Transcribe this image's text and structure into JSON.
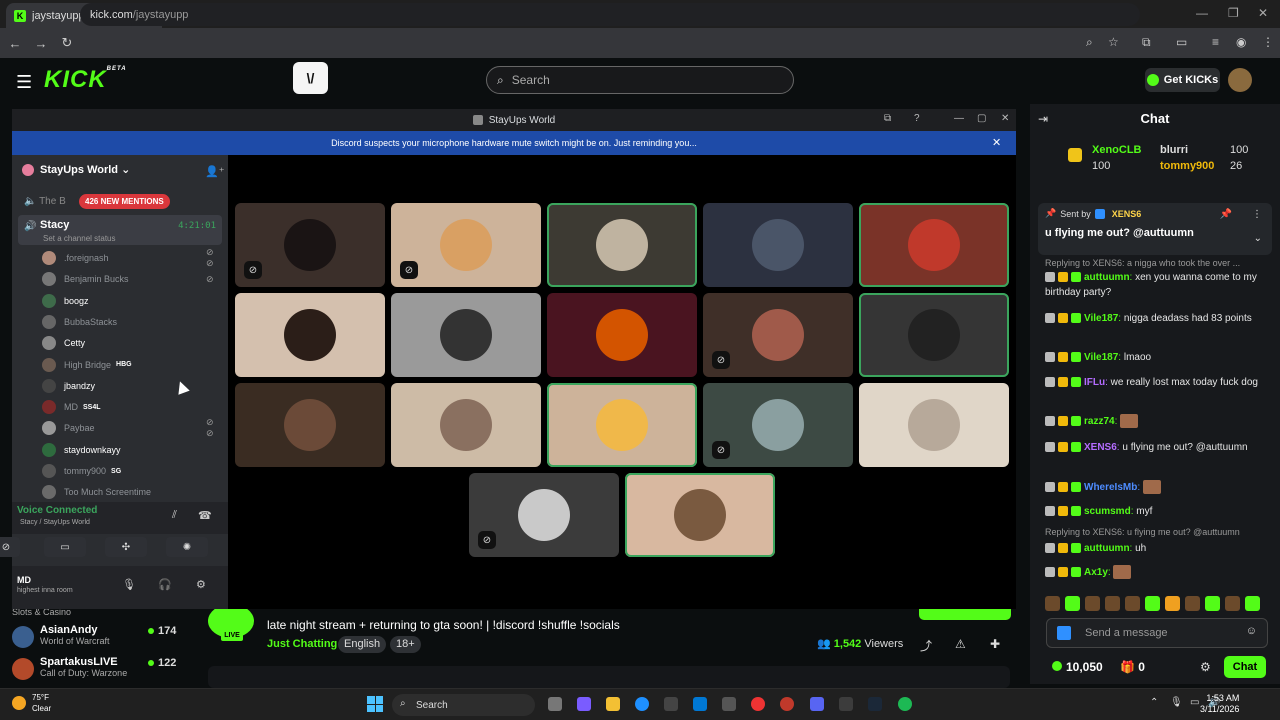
{
  "browser": {
    "tab_title": "jaystayupp Stream - Watch Live",
    "url_host": "kick.com",
    "url_path": "/jaystayupp"
  },
  "kick": {
    "logo": "KICK",
    "logo_sup": "BETA",
    "search_placeholder": "Search",
    "get_kicks_label": "Get KICKs",
    "chat_title": "Chat",
    "leaderboard": [
      {
        "name": "XenoCLB",
        "value": "100"
      },
      {
        "name": "blurri",
        "value": "100"
      },
      {
        "name": "tommy900",
        "value": "26"
      }
    ],
    "leaderboard_extra": "100",
    "pinned": {
      "sent_by_label": "Sent by",
      "sender": "XENS6",
      "message": "u flying me out? @auttuumn"
    },
    "chat_messages": [
      {
        "type": "reply",
        "text": "Replying to XENS6: a nigga who took the over ..."
      },
      {
        "type": "msg",
        "user": "auttuumn",
        "color": "#53fc18",
        "text": "xen you wanna come to my birthday party?"
      },
      {
        "type": "msg",
        "user": "Vile187",
        "color": "#53fc18",
        "text": "nigga deadass had 83 points"
      },
      {
        "type": "msg",
        "user": "Vile187",
        "color": "#53fc18",
        "text": "lmaoo"
      },
      {
        "type": "msg",
        "user": "IFLu",
        "color": "#b46cff",
        "text": "we really lost max today fuck dog"
      },
      {
        "type": "msg",
        "user": "razz74",
        "color": "#53fc18",
        "text": ""
      },
      {
        "type": "msg",
        "user": "XENS6",
        "color": "#b46cff",
        "text": "u flying me out? @auttuumn"
      },
      {
        "type": "msg",
        "user": "WhereIsMb",
        "color": "#4d8cff",
        "text": ""
      },
      {
        "type": "msg",
        "user": "scumsmd",
        "color": "#53fc18",
        "text": "myf"
      },
      {
        "type": "reply",
        "text": "Replying to XENS6: u flying me out? @auttuumn"
      },
      {
        "type": "msg",
        "user": "auttuumn",
        "color": "#53fc18",
        "text": "uh"
      },
      {
        "type": "msg",
        "user": "Ax1y",
        "color": "#53fc18",
        "text": ""
      }
    ],
    "chat_input_placeholder": "Send a message",
    "kicks_balance": "10,050",
    "gift_count": "0",
    "chat_button": "Chat",
    "sidebar_channels": [
      {
        "name": "AsianAndy",
        "category": "World of Warcraft",
        "viewers": "174",
        "avatar_color": "#3a5f8f"
      },
      {
        "name": "SpartakusLIVE",
        "category": "Call of Duty: Warzone",
        "viewers": "122",
        "avatar_color": "#b34a2a"
      }
    ],
    "sidebar_peek": "Slots & Casino",
    "stream": {
      "title": "late night stream + returning to gta soon! | !discord !shuffle !socials",
      "category": "Just Chatting",
      "tags": [
        "English",
        "18+"
      ],
      "viewers": "1,542",
      "viewers_label": "Viewers",
      "live_label": "LIVE"
    }
  },
  "discord": {
    "window_title": "StayUps World",
    "notice": "Discord suspects your microphone hardware mute switch might be on. Just reminding you...",
    "server_name": "StayUps World",
    "channel_above": "The B",
    "mentions_badge": "426 NEW MENTIONS",
    "voice_channel": {
      "name": "Stacy",
      "status": "Set a channel status",
      "timer": "4:21:01"
    },
    "members": [
      {
        "name": ".foreignash",
        "active": false,
        "tag": "",
        "icons": "muted-deafened"
      },
      {
        "name": "Benjamin Bucks",
        "active": false,
        "tag": "",
        "icons": "muted"
      },
      {
        "name": "boogz",
        "active": true,
        "tag": "",
        "icons": ""
      },
      {
        "name": "BubbaStacks",
        "active": false,
        "tag": "",
        "icons": ""
      },
      {
        "name": "Cetty",
        "active": true,
        "tag": "",
        "icons": ""
      },
      {
        "name": "High Bridge",
        "active": false,
        "tag": "HBG",
        "icons": ""
      },
      {
        "name": "jbandzy",
        "active": true,
        "tag": "",
        "icons": ""
      },
      {
        "name": "MD",
        "active": false,
        "tag": "SS4L",
        "icons": ""
      },
      {
        "name": "Paybae",
        "active": false,
        "tag": "",
        "icons": "muted-deafened"
      },
      {
        "name": "staydownkayy",
        "active": true,
        "tag": "",
        "icons": ""
      },
      {
        "name": "tommy900",
        "active": false,
        "tag": "SG",
        "icons": ""
      },
      {
        "name": "Too Much Screentime",
        "active": false,
        "tag": "",
        "icons": ""
      }
    ],
    "voice_connected": "Voice Connected",
    "voice_sub": "Stacy / StayUps World",
    "user": {
      "name": "MD",
      "status": "highest inna room"
    },
    "tiles": [
      {
        "bg": "#3b2f2a",
        "pfp": "#1a1414",
        "speaking": false,
        "muted": true
      },
      {
        "bg": "#cdb39a",
        "pfp": "#d9a063",
        "speaking": false,
        "muted": true
      },
      {
        "bg": "#3d3a33",
        "pfp": "#bfb3a0",
        "speaking": true,
        "muted": false
      },
      {
        "bg": "#2c3140",
        "pfp": "#4a5568",
        "speaking": false,
        "muted": false
      },
      {
        "bg": "#7a3328",
        "pfp": "#c0392b",
        "speaking": true,
        "muted": false
      },
      {
        "bg": "#d4c0ae",
        "pfp": "#2b1e18",
        "speaking": false,
        "muted": false
      },
      {
        "bg": "#9a9a9a",
        "pfp": "#333333",
        "speaking": false,
        "muted": false
      },
      {
        "bg": "#4a1420",
        "pfp": "#d35400",
        "speaking": false,
        "muted": false
      },
      {
        "bg": "#3f2f28",
        "pfp": "#a05a4a",
        "speaking": false,
        "muted": true
      },
      {
        "bg": "#353535",
        "pfp": "#222222",
        "speaking": true,
        "muted": false
      },
      {
        "bg": "#3a2c22",
        "pfp": "#6b4a38",
        "speaking": false,
        "muted": false
      },
      {
        "bg": "#cdbba6",
        "pfp": "#8a7060",
        "speaking": false,
        "muted": false
      },
      {
        "bg": "#cdb39a",
        "pfp": "#f0b84a",
        "speaking": true,
        "muted": false
      },
      {
        "bg": "#3d4a44",
        "pfp": "#8a9fa0",
        "speaking": false,
        "muted": true
      },
      {
        "bg": "#e0d6c8",
        "pfp": "#b7a99a",
        "speaking": false,
        "muted": false
      },
      {
        "bg": "#3b3b3b",
        "pfp": "#c9c9c9",
        "speaking": false,
        "muted": true
      },
      {
        "bg": "#d8b8a0",
        "pfp": "#7a5a40",
        "speaking": true,
        "muted": false
      }
    ]
  },
  "taskbar": {
    "temp": "75°F",
    "weather": "Clear",
    "search": "Search",
    "time": "1:53 AM",
    "date": "3/11/2026"
  }
}
